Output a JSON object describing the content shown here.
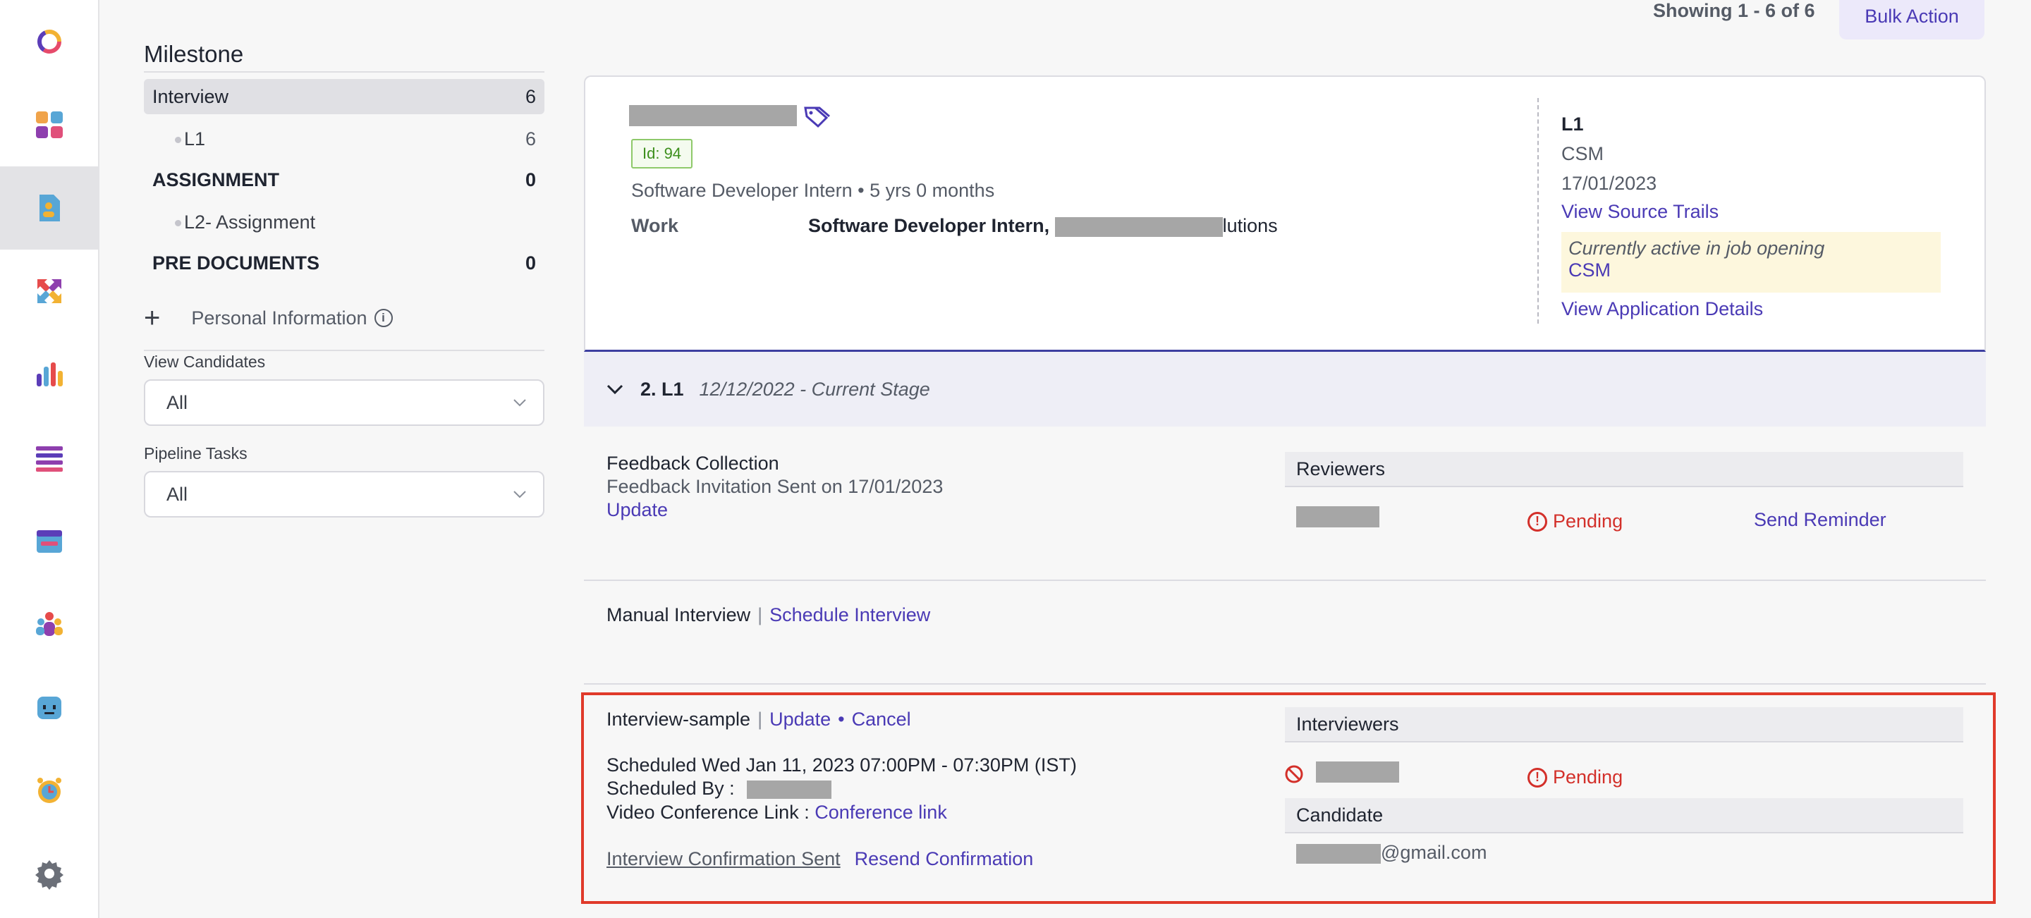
{
  "topbar": {
    "showing_text": "Showing 1 - 6 of 6",
    "bulk_action_label": "Bulk Action"
  },
  "rail": {
    "icons": [
      "logo-ring-icon",
      "dashboard-icon",
      "candidate-document-icon",
      "arrows-exchange-icon",
      "bar-chart-icon",
      "list-icon",
      "calendar-icon",
      "team-icon",
      "bot-icon",
      "alarm-clock-icon",
      "gear-icon"
    ],
    "active_index": 2
  },
  "sidebar": {
    "title": "Milestone",
    "items": [
      {
        "label": "Interview",
        "count": "6"
      },
      {
        "label": "L1",
        "count": "6"
      },
      {
        "label": "ASSIGNMENT",
        "count": "0"
      },
      {
        "label": "L2- Assignment",
        "count": ""
      },
      {
        "label": "PRE DOCUMENTS",
        "count": "0"
      }
    ],
    "personal_info_label": "Personal Information",
    "view_candidates_label": "View Candidates",
    "view_candidates_value": "All",
    "pipeline_tasks_label": "Pipeline Tasks",
    "pipeline_tasks_value": "All"
  },
  "card": {
    "id_badge": "Id: 94",
    "experience": "Software Developer Intern • 5 yrs 0 months",
    "work_label": "Work",
    "work_title": "Software Developer Intern",
    "work_company_suffix": "lutions",
    "stage_code": "L1",
    "job": "CSM",
    "date": "17/01/2023",
    "view_source_trails": "View Source Trails",
    "active_text": "Currently active in job opening",
    "active_job": "CSM",
    "view_application_details": "View Application Details"
  },
  "stage": {
    "name": "2. L1",
    "date_text": "12/12/2022 - Current Stage"
  },
  "feedback": {
    "title": "Feedback Collection",
    "sent_text": "Feedback Invitation Sent on 17/01/2023",
    "update_label": "Update",
    "reviewers_header": "Reviewers",
    "status": "Pending",
    "send_reminder_label": "Send Reminder"
  },
  "manual_interview": {
    "label": "Manual Interview",
    "schedule_label": "Schedule Interview"
  },
  "interview": {
    "name": "Interview-sample",
    "update_label": "Update",
    "cancel_label": "Cancel",
    "scheduled_text": "Scheduled Wed Jan 11, 2023 07:00PM - 07:30PM (IST)",
    "scheduled_by_label": "Scheduled By :",
    "video_link_label": "Video Conference Link :",
    "conference_link": "Conference link",
    "confirmation_sent": "Interview Confirmation Sent",
    "resend_label": "Resend Confirmation",
    "interviewers_header": "Interviewers",
    "interviewer_status": "Pending",
    "candidate_header": "Candidate",
    "candidate_email_suffix": "@gmail.com"
  }
}
